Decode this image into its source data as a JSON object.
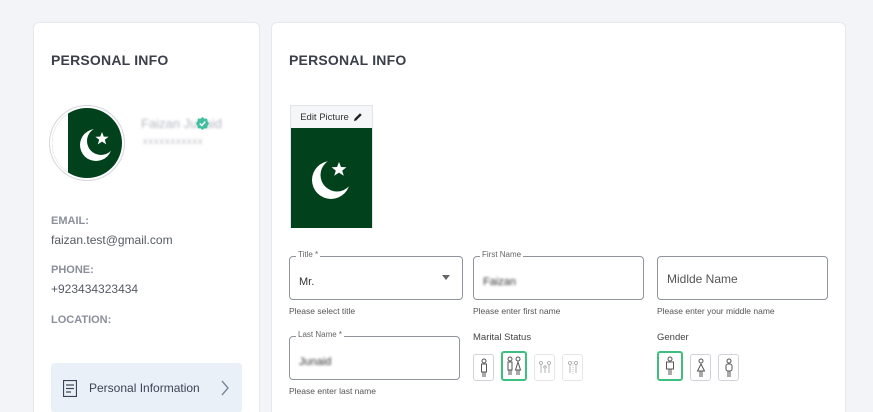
{
  "left_panel": {
    "title": "PERSONAL INFO",
    "profile": {
      "name": "Faizan Junaid",
      "subtitle": "xxxxxxxxxxx",
      "verified_icon": "verified-badge-icon"
    },
    "email_label": "EMAIL:",
    "email_value": "faizan.test@gmail.com",
    "phone_label": "PHONE:",
    "phone_value": "+923434323434",
    "location_label": "LOCATION:",
    "menu_item": {
      "label": "Personal Information",
      "icon": "document-icon",
      "arrow_icon": "chevron-right-icon"
    }
  },
  "right_panel": {
    "title": "PERSONAL INFO",
    "edit_picture_label": "Edit Picture",
    "edit_icon": "pencil-icon",
    "title_field": {
      "legend": "Title *",
      "value": "Mr.",
      "helper": "Please select title"
    },
    "first_name_field": {
      "legend": "First Name",
      "value": "Faizan",
      "helper": "Please enter first name"
    },
    "middle_name_field": {
      "placeholder": "Midlde Name",
      "helper": "Please enter your middle name"
    },
    "last_name_field": {
      "legend": "Last Name *",
      "value": "Junaid",
      "helper": "Please enter last name"
    },
    "marital_status": {
      "label": "Marital Status",
      "options": [
        "single-icon",
        "married-icon",
        "family-icon",
        "divorced-icon"
      ],
      "selected": "married-icon"
    },
    "gender": {
      "label": "Gender",
      "options": [
        "male-icon",
        "female-icon",
        "other-icon"
      ],
      "selected": "male-icon"
    }
  },
  "colors": {
    "accent_green": "#3fbf7f",
    "flag_green": "#01411c",
    "menu_bg": "#e9f0f7",
    "page_bg": "#f3f4f7"
  }
}
